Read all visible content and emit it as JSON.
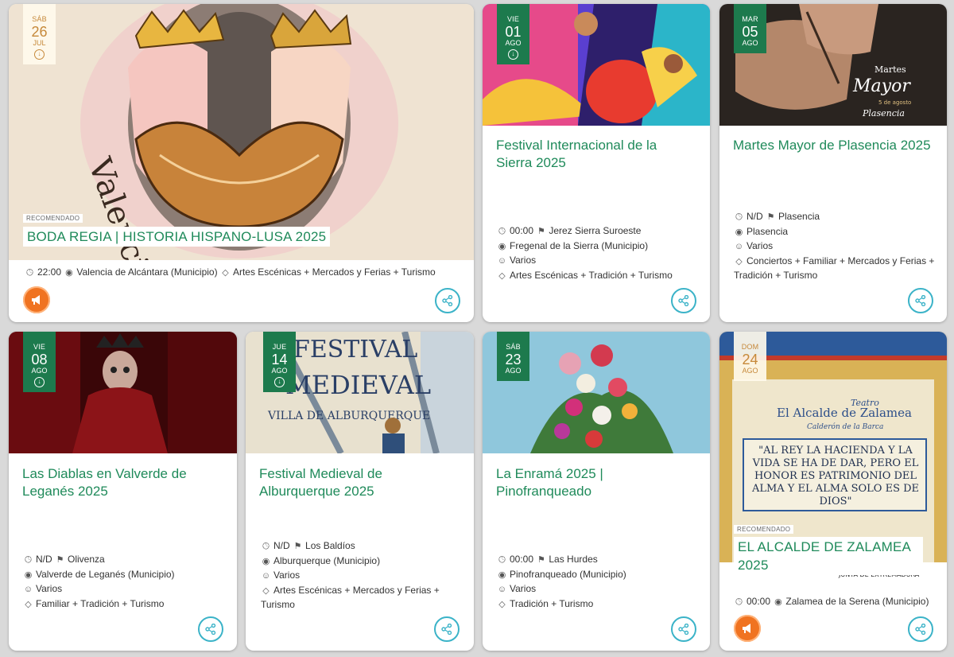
{
  "cards": [
    {
      "date": {
        "dow": "SÁB",
        "day": "26",
        "mon": "JUL"
      },
      "recommended": "RECOMENDADO",
      "title": "BODA REGIA | HISTORIA HISPANO-LUSA 2025",
      "meta": {
        "time": "22:00",
        "place": "Valencia de Alcántara (Municipio)",
        "tags": "Artes Escénicas + Mercados y Ferias + Turismo"
      },
      "image_text": "Valencia de Alcántara · Marvão"
    },
    {
      "date": {
        "dow": "VIE",
        "day": "01",
        "mon": "AGO"
      },
      "title": "Festival Internacional de la Sierra 2025",
      "meta": {
        "time": "00:00",
        "zone": "Jerez Sierra Suroeste",
        "place": "Fregenal de la Sierra (Municipio)",
        "audience": "Varios",
        "tags": "Artes Escénicas + Tradición + Turismo"
      }
    },
    {
      "date": {
        "dow": "MAR",
        "day": "05",
        "mon": "AGO"
      },
      "title": "Martes Mayor de Plasencia 2025",
      "meta": {
        "time": "N/D",
        "zone": "Plasencia",
        "place": "Plasencia",
        "audience": "Varios",
        "tags": "Conciertos + Familiar + Mercados y Ferias + Tradición + Turismo"
      },
      "image_text": {
        "l1": "Martes",
        "l2": "Mayor",
        "l3": "5 de agosto",
        "l4": "Plasencia"
      }
    },
    {
      "date": {
        "dow": "VIE",
        "day": "08",
        "mon": "AGO"
      },
      "title": "Las Diablas en Valverde de Leganés 2025",
      "meta": {
        "time": "N/D",
        "zone": "Olivenza",
        "place": "Valverde de Leganés (Municipio)",
        "audience": "Varios",
        "tags": "Familiar + Tradición + Turismo"
      }
    },
    {
      "date": {
        "dow": "JUE",
        "day": "14",
        "mon": "AGO"
      },
      "title": "Festival Medieval de Alburquerque 2025",
      "meta": {
        "time": "N/D",
        "zone": "Los Baldíos",
        "place": "Alburquerque (Municipio)",
        "audience": "Varios",
        "tags": "Artes Escénicas + Mercados y Ferias + Turismo"
      },
      "image_text": {
        "l1": "FESTIVAL",
        "l2": "MEDIEVAL",
        "l3": "VILLA DE ALBURQUERQUE"
      }
    },
    {
      "date": {
        "dow": "SÁB",
        "day": "23",
        "mon": "AGO"
      },
      "title": "La Enramá 2025 | Pinofranqueado",
      "meta": {
        "time": "00:00",
        "zone": "Las Hurdes",
        "place": "Pinofranqueado (Municipio)",
        "audience": "Varios",
        "tags": "Tradición + Turismo"
      }
    },
    {
      "date": {
        "dow": "DOM",
        "day": "24",
        "mon": "AGO"
      },
      "recommended": "RECOMENDADO",
      "title": "EL ALCALDE DE ZALAMEA 2025",
      "meta": {
        "time": "00:00",
        "place": "Zalamea de la Serena (Municipio)"
      },
      "image_text": {
        "l1": "Teatro",
        "l2": "El Alcalde de Zalamea",
        "l3": "Calderón de la Barca",
        "l4": "\"AL REY LA HACIENDA Y LA VIDA SE HA DE DAR, PERO EL HONOR ES PATRIMONIO DEL ALMA Y EL ALMA SOLO ES DE DIOS\"",
        "l5": "JUNTA DE EXTREMADURA"
      }
    }
  ],
  "icons": [
    "clock-icon",
    "signpost-icon",
    "location-pin-icon",
    "user-icon",
    "tag-icon",
    "download-icon",
    "share-icon",
    "megaphone-icon"
  ],
  "colors": {
    "accent_green": "#1f8a5a",
    "date_green": "#1d7a4d",
    "share_teal": "#3bb3c8",
    "megaphone_orange": "#f07321",
    "background": "#d9d9d9"
  }
}
